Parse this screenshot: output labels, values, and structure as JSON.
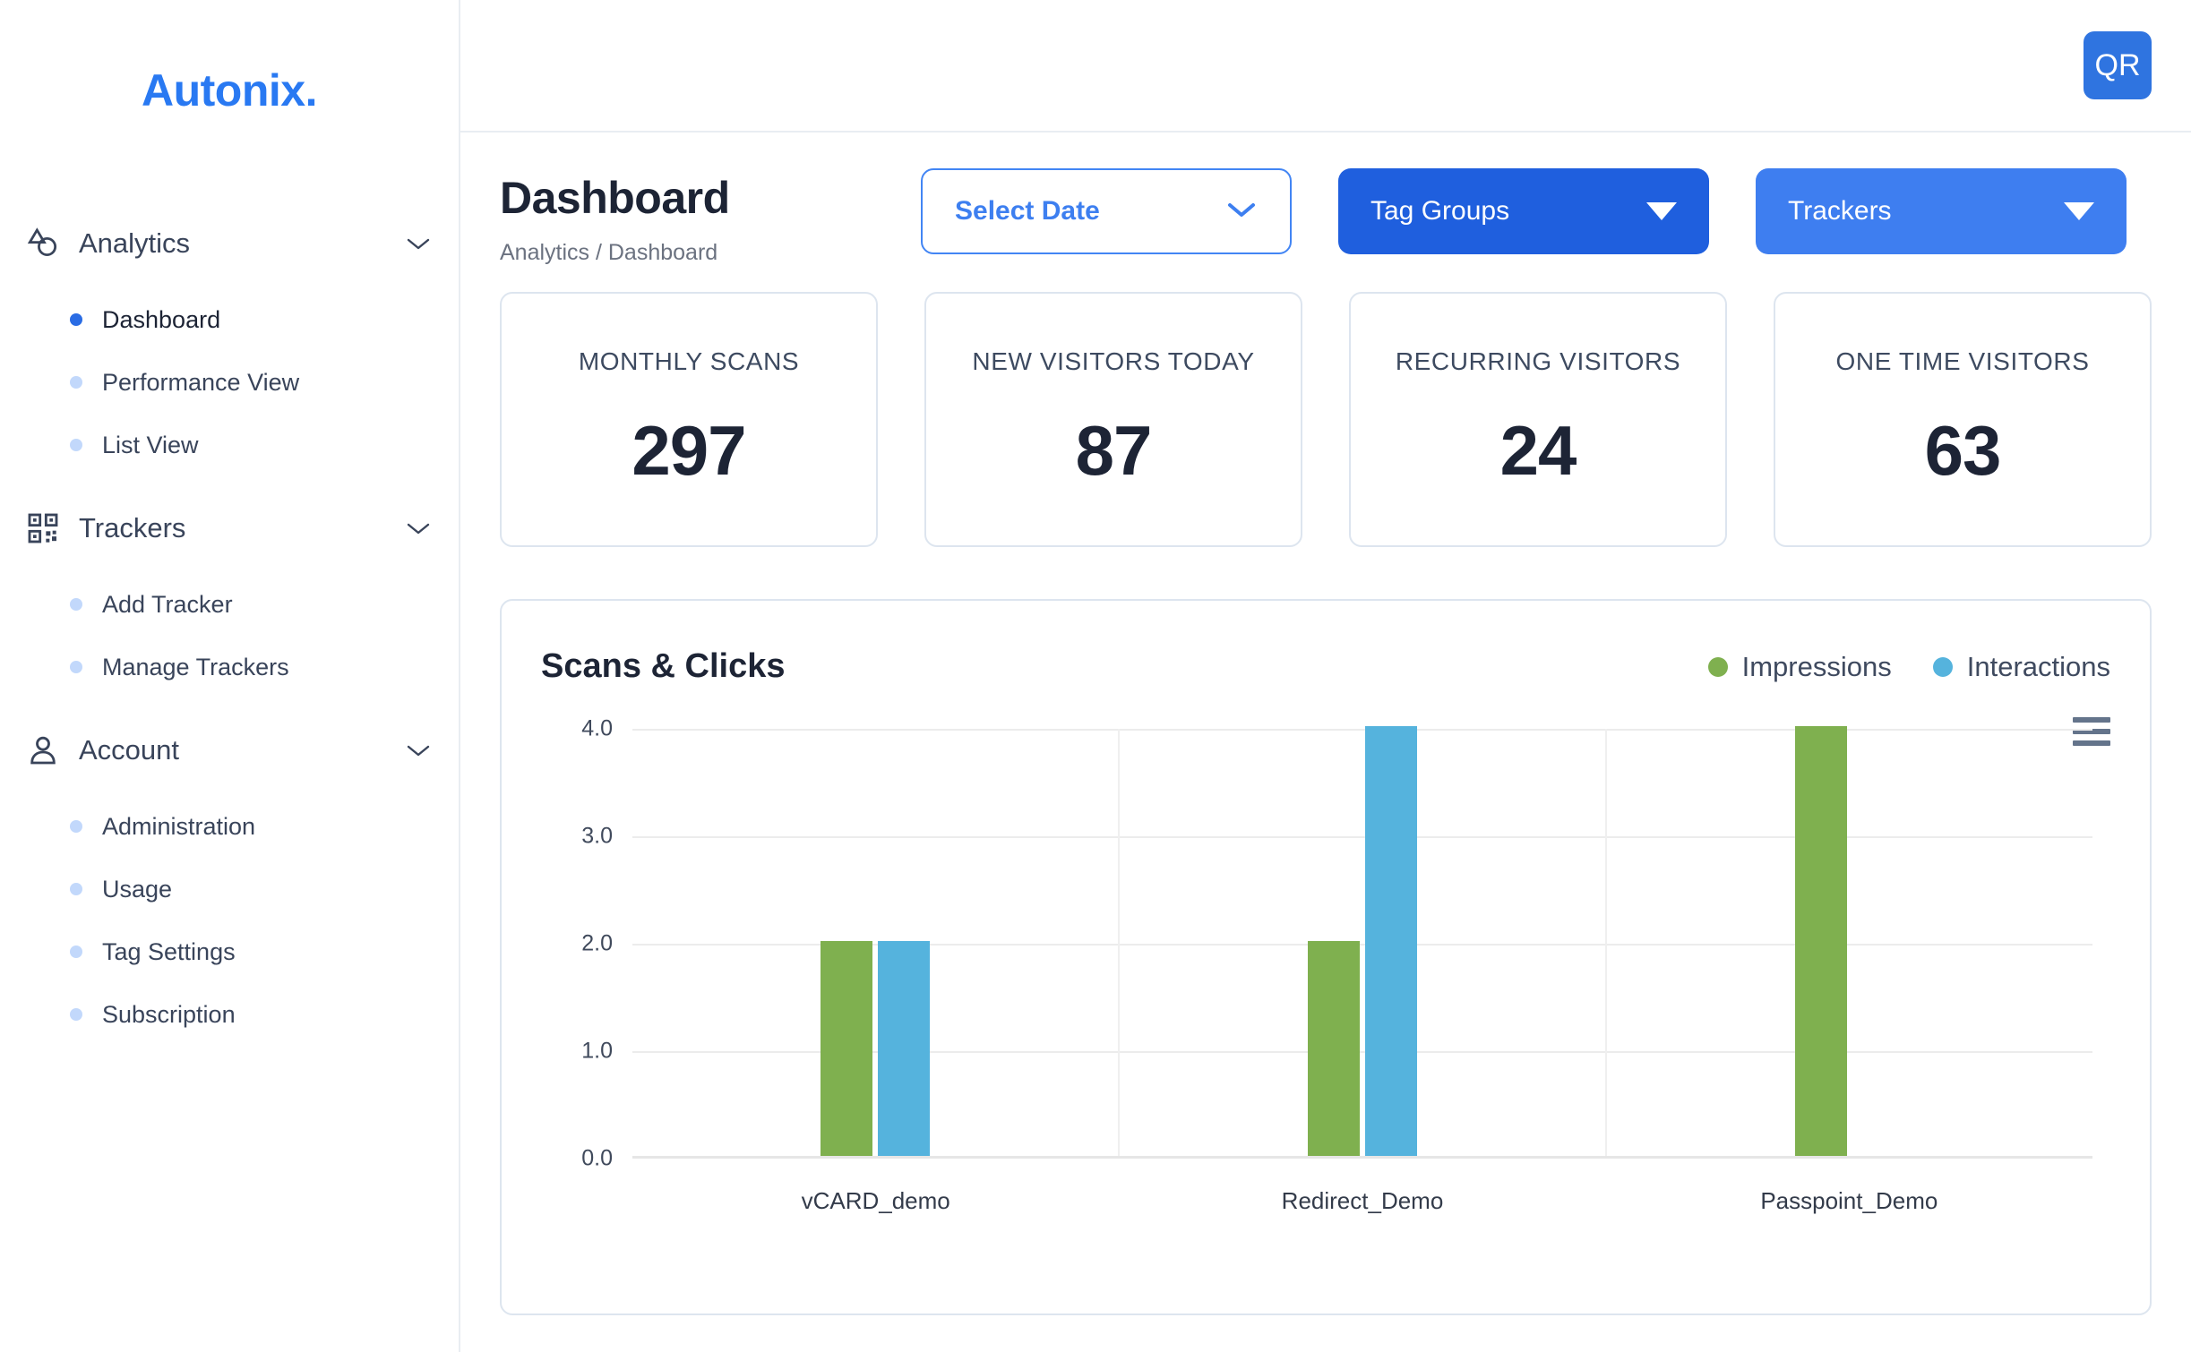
{
  "brand": {
    "name": "Autonix."
  },
  "topbar": {
    "qr_button_label": "QR"
  },
  "sidebar": {
    "groups": [
      {
        "label": "Analytics",
        "icon": "shapes-analytics-icon",
        "expanded": true,
        "items": [
          {
            "label": "Dashboard",
            "active": true
          },
          {
            "label": "Performance View",
            "active": false
          },
          {
            "label": "List View",
            "active": false
          }
        ]
      },
      {
        "label": "Trackers",
        "icon": "qr-code-icon",
        "expanded": true,
        "items": [
          {
            "label": "Add Tracker",
            "active": false
          },
          {
            "label": "Manage Trackers",
            "active": false
          }
        ]
      },
      {
        "label": "Account",
        "icon": "person-icon",
        "expanded": true,
        "items": [
          {
            "label": "Administration",
            "active": false
          },
          {
            "label": "Usage",
            "active": false
          },
          {
            "label": "Tag Settings",
            "active": false
          },
          {
            "label": "Subscription",
            "active": false
          }
        ]
      }
    ]
  },
  "page": {
    "title": "Dashboard",
    "breadcrumb": "Analytics / Dashboard"
  },
  "controls": {
    "select_date_label": "Select Date",
    "tag_groups_label": "Tag Groups",
    "trackers_label": "Trackers"
  },
  "stats": [
    {
      "label": "MONTHLY SCANS",
      "value": "297"
    },
    {
      "label": "NEW VISITORS TODAY",
      "value": "87"
    },
    {
      "label": "RECURRING VISITORS",
      "value": "24"
    },
    {
      "label": "ONE TIME VISITORS",
      "value": "63"
    }
  ],
  "colors": {
    "brand_blue": "#2979f2",
    "pill_dark": "#1f5fde",
    "pill_light": "#3e7ef0",
    "impressions_green": "#7fb04f",
    "interactions_blue": "#55b3dd",
    "active_dot": "#2a6ce4",
    "inactive_dot": "#c2d8fb"
  },
  "chart_data": {
    "type": "bar",
    "title": "Scans & Clicks",
    "categories": [
      "vCARD_demo",
      "Redirect_Demo",
      "Passpoint_Demo"
    ],
    "series": [
      {
        "name": "Impressions",
        "color": "#7fb04f",
        "values": [
          2,
          2,
          4
        ]
      },
      {
        "name": "Interactions",
        "color": "#55b3dd",
        "values": [
          2,
          4,
          0
        ]
      }
    ],
    "xlabel": "",
    "ylabel": "",
    "ylim": [
      0,
      4
    ],
    "yticks": [
      "0.0",
      "1.0",
      "2.0",
      "3.0",
      "4.0"
    ],
    "grid": true,
    "legend_position": "top-right",
    "menu_icon": "hamburger-menu-icon"
  }
}
